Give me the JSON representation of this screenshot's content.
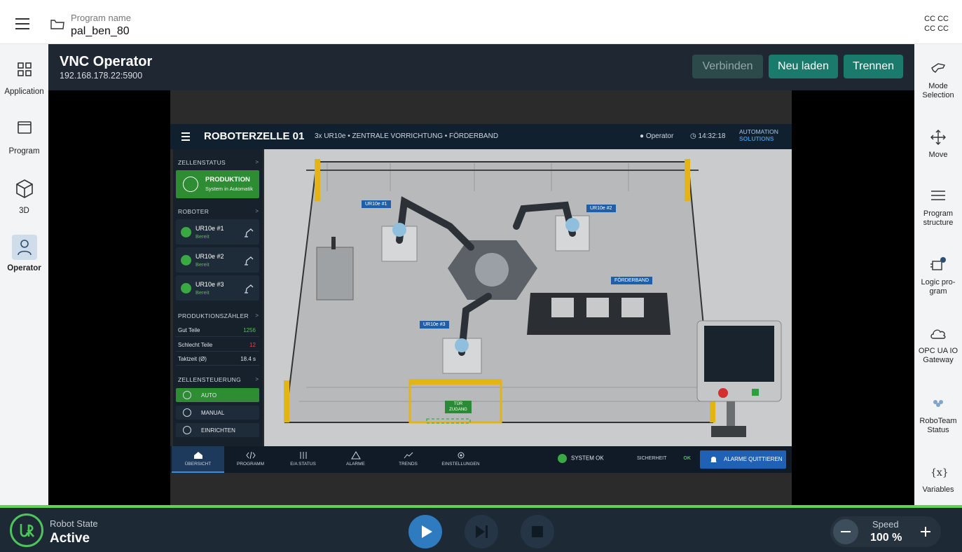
{
  "topbar": {
    "program_label": "Program name",
    "program_name": "pal_ben_80",
    "cc_line1": "CC CC",
    "cc_line2": "CC CC"
  },
  "leftnav": {
    "items": [
      {
        "label": "Application",
        "icon": "grid-icon"
      },
      {
        "label": "Program",
        "icon": "window-icon"
      },
      {
        "label": "3D",
        "icon": "cube-icon"
      },
      {
        "label": "Operator",
        "icon": "person-icon",
        "active": true
      }
    ]
  },
  "rightnav": {
    "items": [
      {
        "label": "Mode Selection",
        "icon": "hand-icon"
      },
      {
        "label": "Move",
        "icon": "move-arrows-icon"
      },
      {
        "label": "Program structure",
        "icon": "list-icon"
      },
      {
        "label": "Logic pro-gram",
        "icon": "logic-chip-icon"
      },
      {
        "label": "OPC UA IO Gateway",
        "icon": "cloud-icon"
      },
      {
        "label": "RoboTeam Status",
        "icon": "team-icon"
      },
      {
        "label": "Variables",
        "icon": "variable-icon"
      }
    ]
  },
  "vnc": {
    "title": "VNC Operator",
    "address": "192.168.178.22:5900",
    "btn_connect": "Verbinden",
    "btn_reload": "Neu laden",
    "btn_disconnect": "Trennen"
  },
  "hmi": {
    "title": "ROBOTERZELLE 01",
    "subtitle": "3x UR10e  •  ZENTRALE VORRICHTUNG  •  FÖRDERBAND",
    "user": "Operator",
    "time": "14:32:18",
    "logo_line1": "AUTOMATION",
    "logo_line2": "SOLUTIONS",
    "sections": {
      "cell_status": "ZELLENSTATUS",
      "robots": "ROBOTER",
      "counter": "PRODUKTIONSZÄHLER",
      "control": "ZELLENSTEUERUNG"
    },
    "production": {
      "title": "PRODUKTION",
      "sub": "System in Automatik"
    },
    "robots": [
      {
        "name": "UR10e #1",
        "state": "Bereit"
      },
      {
        "name": "UR10e #2",
        "state": "Bereit"
      },
      {
        "name": "UR10e #3",
        "state": "Bereit"
      }
    ],
    "counters": [
      {
        "key": "Gut Teile",
        "value": "1256",
        "color": "#52c050"
      },
      {
        "key": "Schlecht Teile",
        "value": "12",
        "color": "#e34848"
      },
      {
        "key": "Taktzeit (Ø)",
        "value": "18.4 s",
        "color": "#dfe5ea"
      }
    ],
    "modes": [
      {
        "label": "AUTO",
        "active": true
      },
      {
        "label": "MANUAL",
        "active": false
      },
      {
        "label": "EINRICHTEN",
        "active": false
      }
    ],
    "scene_labels": {
      "r1": "UR10e #1",
      "r2": "UR10e #2",
      "r3": "UR10e #3",
      "conveyor": "FÖRDERBAND",
      "door": "TÜR ZUGANG"
    },
    "tabs": [
      {
        "label": "ÜBERSICHT",
        "active": true
      },
      {
        "label": "PROGRAMM"
      },
      {
        "label": "E/A STATUS"
      },
      {
        "label": "ALARME"
      },
      {
        "label": "TRENDS"
      },
      {
        "label": "EINSTELLUNGEN"
      }
    ],
    "system_ok": "SYSTEM OK",
    "safety_label": "SICHERHEIT",
    "safety_value": "OK",
    "ack_alarms": "ALARME QUITTIEREN"
  },
  "bottombar": {
    "robot_state_label": "Robot State",
    "robot_state_value": "Active",
    "speed_label": "Speed",
    "speed_value": "100 %"
  },
  "colors": {
    "accent_green": "#5bd45b",
    "teal_button": "#1a7a6c",
    "play_blue": "#2f7bbf"
  }
}
